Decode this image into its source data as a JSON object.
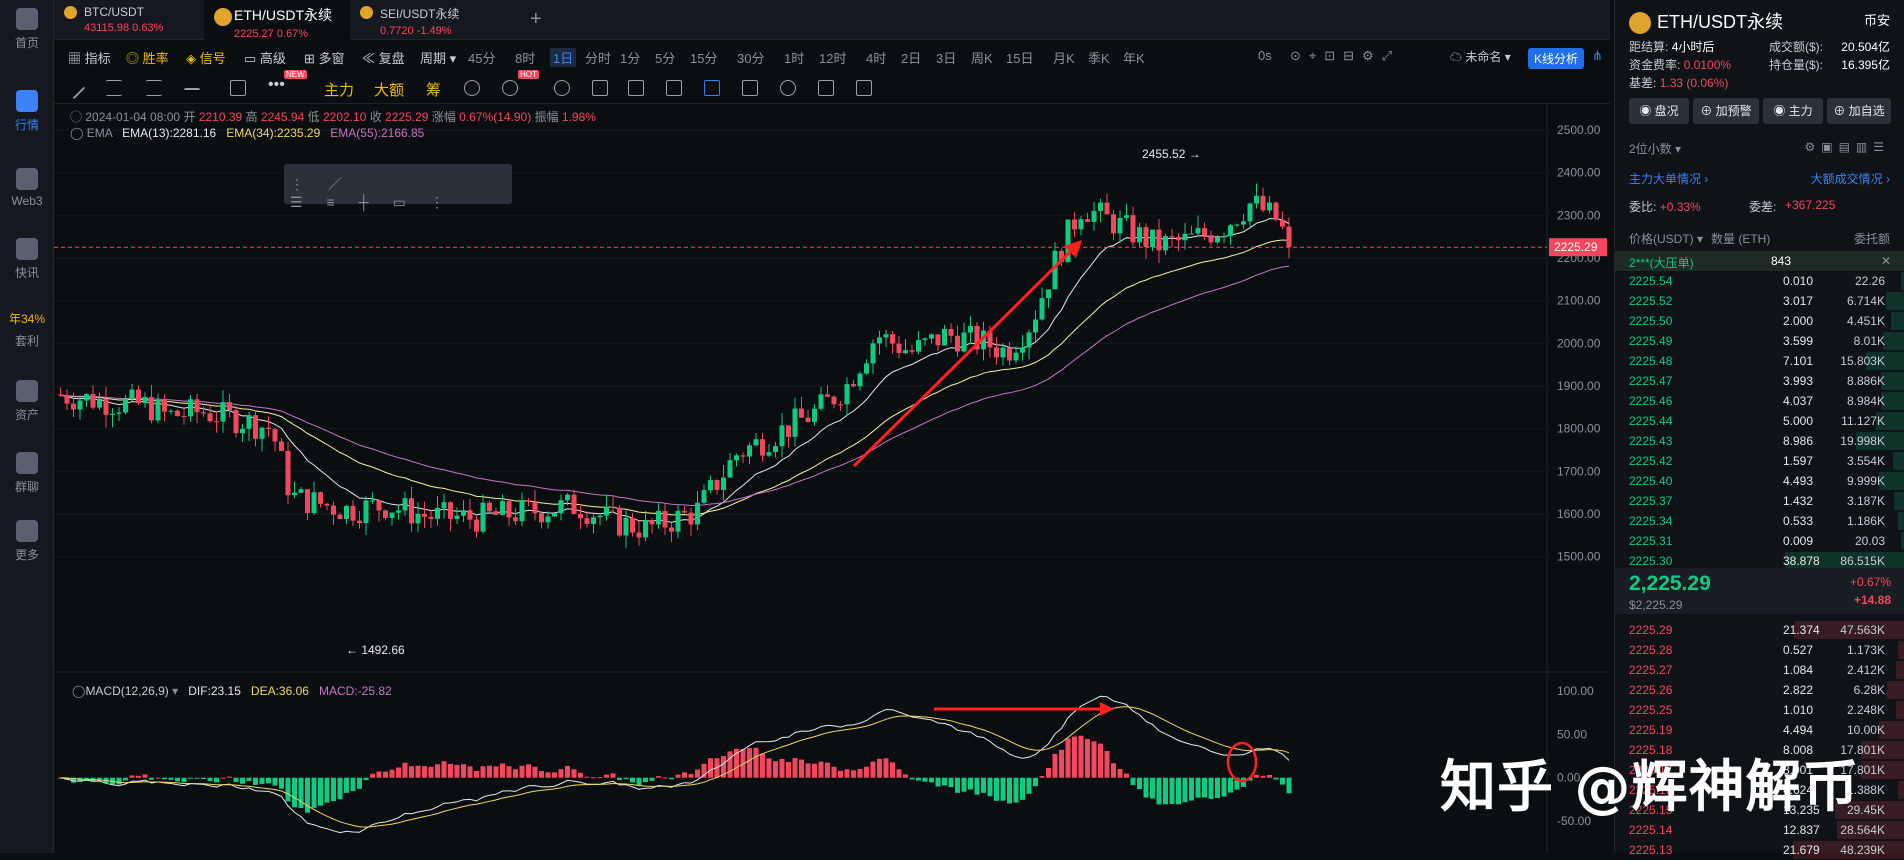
{
  "sidebar": [
    {
      "label": "首页"
    },
    {
      "label": "行情",
      "active": true
    },
    {
      "label": "Web3"
    },
    {
      "label": "快讯"
    },
    {
      "label": "年34%"
    },
    {
      "label": "套利"
    },
    {
      "label": "资产"
    },
    {
      "label": "群聊"
    },
    {
      "label": "更多"
    }
  ],
  "tabs": [
    {
      "name": "BTC/USDT",
      "price": "43115.98",
      "chg": "0.63%"
    },
    {
      "name": "ETH/USDT永续",
      "price": "2225.27",
      "chg": "0.67%"
    },
    {
      "name": "SEI/USDT永续",
      "price": "0.7720",
      "chg": "-1.49%"
    }
  ],
  "toolbar1": {
    "indicator": "指标",
    "winrate": "胜率",
    "signal": "信号",
    "advanced": "高级",
    "multi": "多窗",
    "replay": "复盘",
    "period": "周期",
    "intervals": [
      "45分",
      "8时",
      "1日",
      "分时",
      "1分",
      "5分",
      "15分",
      "30分",
      "1时",
      "12时",
      "4时",
      "2日",
      "3日",
      "周K",
      "15日",
      "月K",
      "季K",
      "年K"
    ],
    "active_interval": "1日",
    "zero_s": "0s",
    "unnamed": "未命名",
    "kline_btn": "K线分析"
  },
  "toolbar2": {
    "main": "主力",
    "large": "大额",
    "chip": "筹",
    "new": "NEW",
    "hot": "HOT"
  },
  "ohlc": {
    "date": "2024-01-04 08:00",
    "open_l": "开",
    "open": "2210.39",
    "high_l": "高",
    "high": "2245.94",
    "low_l": "低",
    "low": "2202.10",
    "close_l": "收",
    "close": "2225.29",
    "chg_l": "涨幅",
    "chg": "0.67%(14.90)",
    "amp_l": "振幅",
    "amp": "1.98%"
  },
  "ema": {
    "label": "EMA",
    "e13": "EMA(13):2281.16",
    "e34": "EMA(34):2235.29",
    "e55": "EMA(55):2166.85"
  },
  "macd": {
    "label": "MACD(12,26,9)",
    "dif": "DIF:23.15",
    "dea": "DEA:36.06",
    "macd": "MACD:-25.82"
  },
  "annot": {
    "high": "2455.52",
    "low": "1492.66",
    "last": "2225.29"
  },
  "price_axis": [
    "2500.00",
    "2400.00",
    "2300.00",
    "2200.00",
    "2100.00",
    "2000.00",
    "1900.00",
    "1800.00",
    "1700.00",
    "1600.00",
    "1500.00"
  ],
  "macd_axis": [
    "100.00",
    "50.00",
    "0.00",
    "-50.00"
  ],
  "colors": {
    "up": "#0ecb81",
    "down": "#f6465d",
    "accent": "#f0b90b",
    "ema13": "#f3f3a0",
    "ema34": "#e8e8e8",
    "ema55": "#c774c7"
  },
  "panel": {
    "title": "ETH/USDT永续",
    "exch": "币安",
    "settle_l": "距结算:",
    "settle": "4小时后",
    "vol_l": "成交额($):",
    "vol": "20.504亿",
    "fund_l": "资金费率:",
    "fund": "0.0100%",
    "oi_l": "持仓量($):",
    "oi": "16.395亿",
    "basis_l": "基差:",
    "basis": "1.33 (0.06%)",
    "btns": [
      "盘况",
      "加预警",
      "主力",
      "加自选"
    ],
    "dec": "2位小数",
    "mainorder": "主力大单情况",
    "bigtrade": "大额成交情况",
    "ratio_l": "委比:",
    "ratio": "+0.33%",
    "diff_l": "委差:",
    "diff": "+367.225",
    "col_price": "价格(USDT)",
    "col_qty": "数量 (ETH)",
    "col_amt": "委托额",
    "big_label": "2***(大压单)",
    "big_qty": "843",
    "last": "2,225.29",
    "last_usd": "$2,225.29",
    "last_pct": "+0.67%",
    "last_chg": "+14.88"
  },
  "asks": [
    [
      "2225.54",
      "0.010",
      "22.26"
    ],
    [
      "2225.52",
      "3.017",
      "6.714K"
    ],
    [
      "2225.50",
      "2.000",
      "4.451K"
    ],
    [
      "2225.49",
      "3.599",
      "8.01K"
    ],
    [
      "2225.48",
      "7.101",
      "15.803K"
    ],
    [
      "2225.47",
      "3.993",
      "8.886K"
    ],
    [
      "2225.46",
      "4.037",
      "8.984K"
    ],
    [
      "2225.44",
      "5.000",
      "11.127K"
    ],
    [
      "2225.43",
      "8.986",
      "19.998K"
    ],
    [
      "2225.42",
      "1.597",
      "3.554K"
    ],
    [
      "2225.40",
      "4.493",
      "9.999K"
    ],
    [
      "2225.37",
      "1.432",
      "3.187K"
    ],
    [
      "2225.34",
      "0.533",
      "1.186K"
    ],
    [
      "2225.31",
      "0.009",
      "20.03"
    ],
    [
      "2225.30",
      "38.878",
      "86.515K"
    ]
  ],
  "bids": [
    [
      "2225.29",
      "21.374",
      "47.563K"
    ],
    [
      "2225.28",
      "0.527",
      "1.173K"
    ],
    [
      "2225.27",
      "1.084",
      "2.412K"
    ],
    [
      "2225.26",
      "2.822",
      "6.28K"
    ],
    [
      "2225.25",
      "1.010",
      "2.248K"
    ],
    [
      "2225.19",
      "4.494",
      "10.00K"
    ],
    [
      "2225.18",
      "8.008",
      "17.801K"
    ],
    [
      "2225.17",
      "8.001",
      "17.801K"
    ],
    [
      "2225.16",
      "0.624",
      "1.388K"
    ],
    [
      "2225.15",
      "13.235",
      "29.45K"
    ],
    [
      "2225.14",
      "12.837",
      "28.564K"
    ],
    [
      "2225.13",
      "21.679",
      "48.239K"
    ]
  ],
  "watermark": "知乎 @辉神解币"
}
